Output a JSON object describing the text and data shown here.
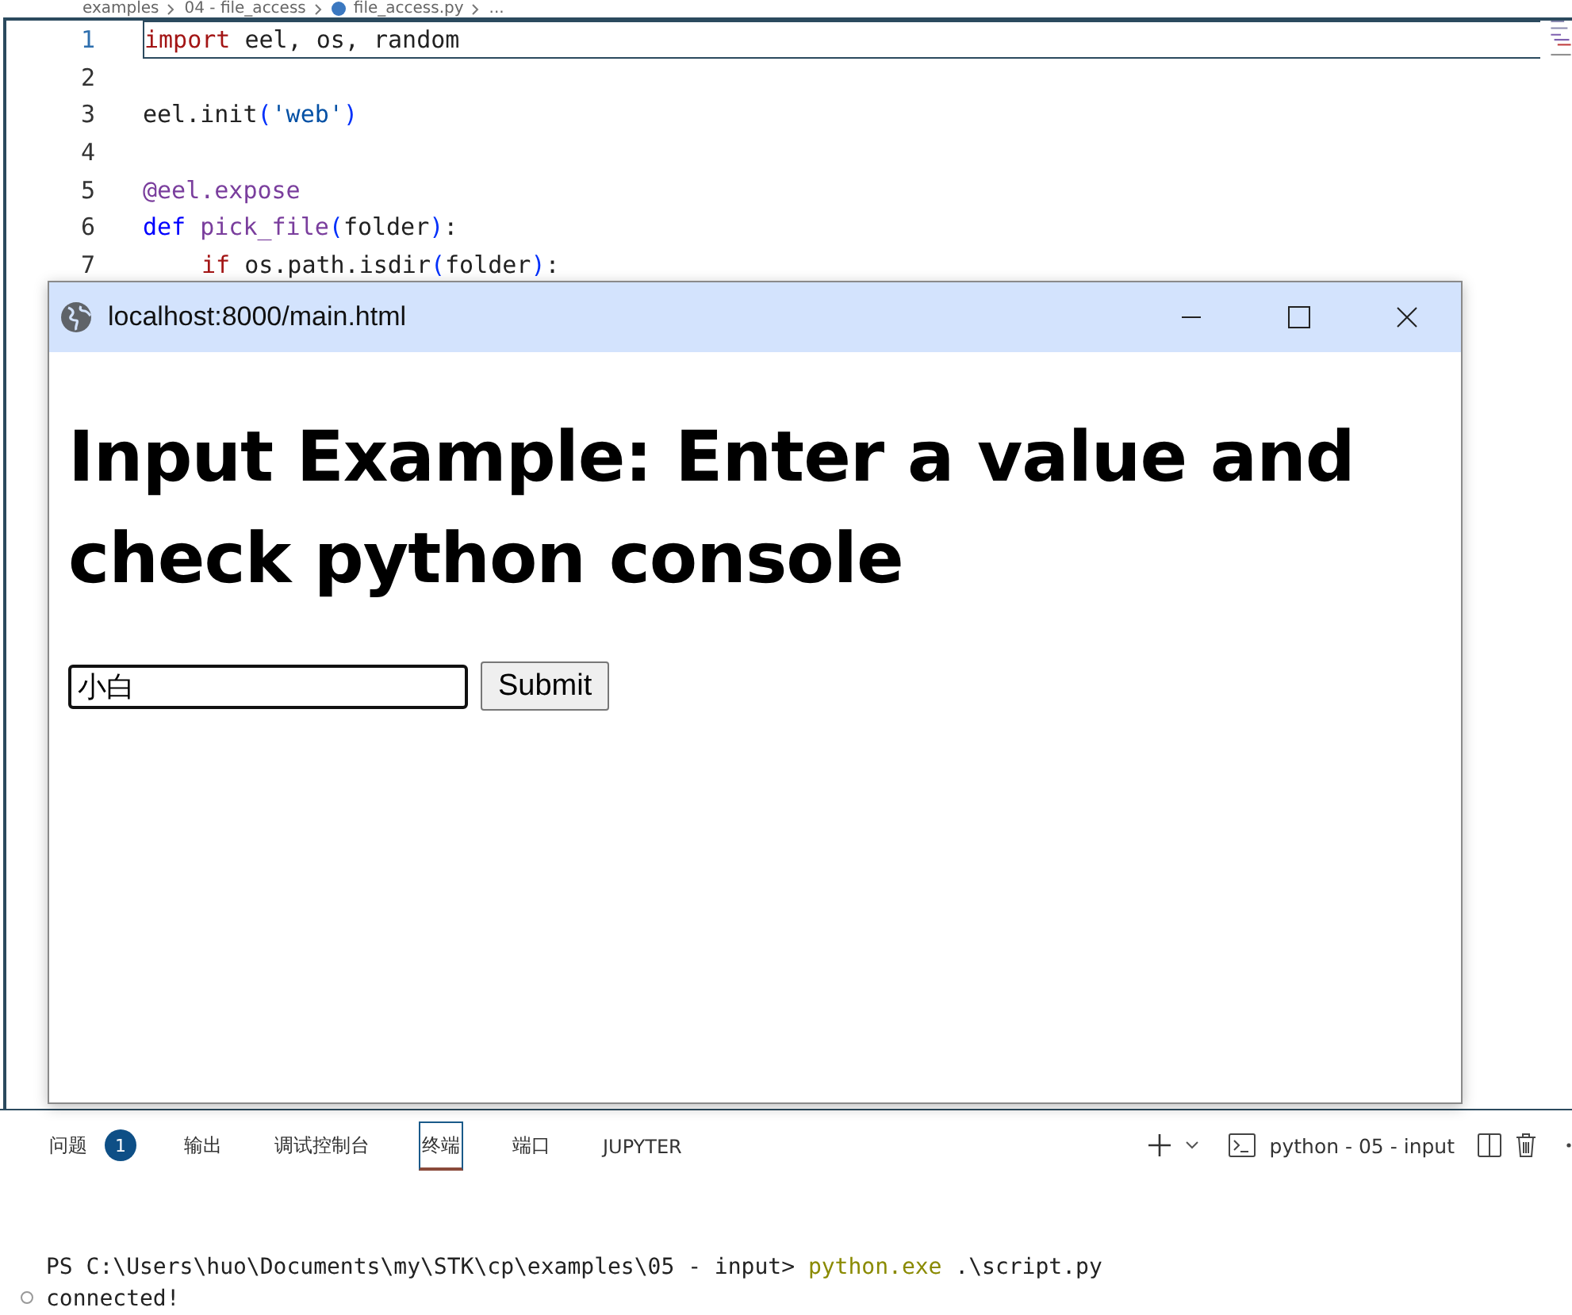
{
  "breadcrumb": [
    "examples",
    "04 - file_access",
    "file_access.py",
    "..."
  ],
  "editor": {
    "lines": [
      {
        "number": "1",
        "active": true,
        "tokens": [
          {
            "kind": "keyword",
            "text": "import"
          },
          {
            "kind": "plain",
            "text": " eel, os, random"
          }
        ]
      },
      {
        "number": "2",
        "active": false
      },
      {
        "number": "3",
        "active": false,
        "tokens": [
          {
            "kind": "plain",
            "text": "eel.init"
          },
          {
            "kind": "paren",
            "text": "("
          },
          {
            "kind": "string",
            "text": "'web'"
          },
          {
            "kind": "paren",
            "text": ")"
          }
        ]
      },
      {
        "number": "4",
        "active": false
      },
      {
        "number": "5",
        "active": false,
        "tokens": [
          {
            "kind": "decorator",
            "text": "@eel.expose"
          }
        ]
      },
      {
        "number": "6",
        "active": false,
        "tokens": [
          {
            "kind": "storage",
            "text": "def "
          },
          {
            "kind": "function",
            "text": "pick_file"
          },
          {
            "kind": "paren",
            "text": "("
          },
          {
            "kind": "plain",
            "text": "folder"
          },
          {
            "kind": "paren",
            "text": ")"
          },
          {
            "kind": "plain",
            "text": ":"
          }
        ]
      },
      {
        "number": "7",
        "active": false,
        "indented": true,
        "tokens": [
          {
            "kind": "keyword",
            "text": "if"
          },
          {
            "kind": "plain",
            "text": " os.path.isdir"
          },
          {
            "kind": "paren",
            "text": "("
          },
          {
            "kind": "plain",
            "text": "folder"
          },
          {
            "kind": "paren",
            "text": ")"
          },
          {
            "kind": "plain",
            "text": ":"
          }
        ]
      }
    ]
  },
  "browser_window": {
    "title": "localhost:8000/main.html",
    "heading": "Input Example: Enter a value and check python console",
    "input": {
      "value": "小白"
    },
    "button": "Submit"
  },
  "panel": {
    "tabs": [
      {
        "label": "问题",
        "badge": "1",
        "selected": false
      },
      {
        "label": "输出",
        "selected": false
      },
      {
        "label": "调试控制台",
        "selected": false
      },
      {
        "label": "终端",
        "selected": true
      },
      {
        "label": "端口",
        "selected": false
      },
      {
        "label": "JUPYTER",
        "selected": false
      }
    ],
    "terminal_name": "python - 05 - input",
    "terminal_lines": [
      {
        "tokens": [
          {
            "kind": "plain",
            "text": "PS C:\\Users\\huo\\Documents\\my\\STK\\cp\\examples\\05 - input> "
          },
          {
            "kind": "command",
            "text": "python.exe"
          },
          {
            "kind": "plain",
            "text": " .\\script.py"
          }
        ]
      },
      {
        "tokens": [
          {
            "kind": "plain",
            "text": "connected!"
          }
        ]
      }
    ]
  }
}
